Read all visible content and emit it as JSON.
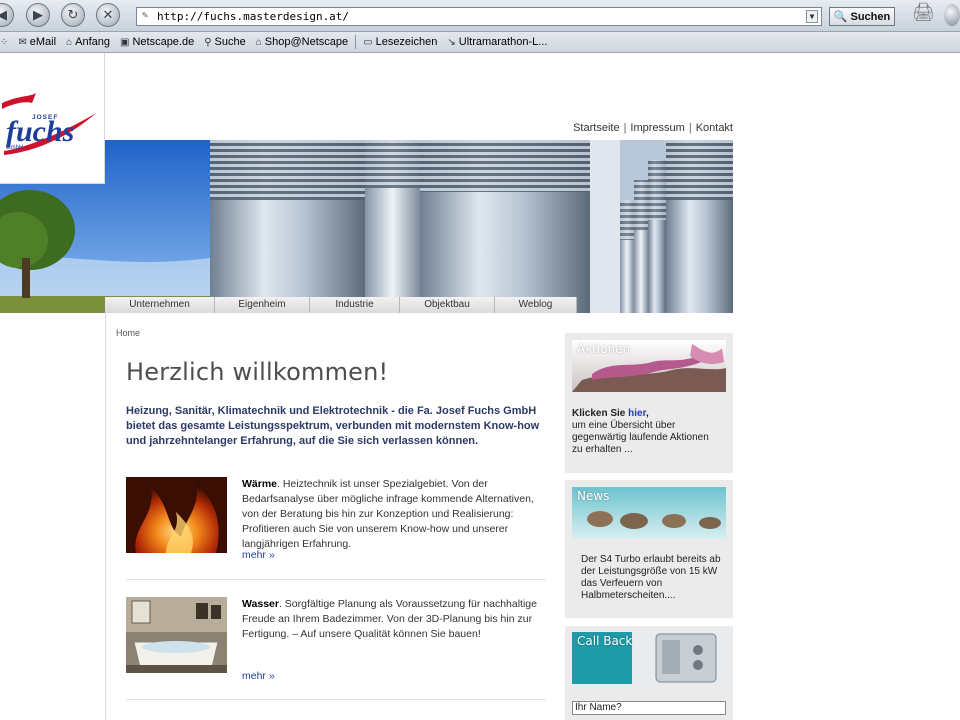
{
  "browser": {
    "url": "http://fuchs.masterdesign.at/",
    "search_button": "Suchen",
    "bookmarks": [
      {
        "label": "eMail",
        "icon": "mail-icon"
      },
      {
        "label": "Anfang",
        "icon": "home-icon"
      },
      {
        "label": "Netscape.de",
        "icon": "my-icon"
      },
      {
        "label": "Suche",
        "icon": "search-icon"
      },
      {
        "label": "Shop@Netscape",
        "icon": "shop-icon"
      },
      {
        "label": "Lesezeichen",
        "icon": "folder-icon"
      },
      {
        "label": "Ultramarathon-L...",
        "icon": "link-icon"
      }
    ]
  },
  "site": {
    "logo": {
      "prefix": "JOSEF",
      "name": "fuchs",
      "suffix": "GmbH"
    },
    "top_links": [
      "Startseite",
      "Impressum",
      "Kontakt"
    ],
    "nav_tabs": [
      "Unternehmen",
      "Eigenheim",
      "Industrie",
      "Objektbau",
      "Weblog"
    ],
    "breadcrumb": "Home",
    "title": "Herzlich willkommen!",
    "intro": "Heizung, Sanitär, Klimatechnik und Elektrotechnik - die Fa. Josef Fuchs GmbH bietet das gesamte Leistungsspektrum, verbunden mit modernstem Know-how und jahrzehntelanger Erfahrung, auf die Sie sich verlassen können.",
    "features": [
      {
        "heading": "Wärme",
        "text": ". Heiztechnik ist unser Spezialgebiet. Von der Bedarfsanalyse über mögliche infrage kommende Alternativen, von der Beratung bis hin zur Konzeption und Realisierung: Profitieren auch Sie von unserem Know-how und unserer langjährigen Erfahrung.",
        "more": "mehr »"
      },
      {
        "heading": "Wasser",
        "text": ". Sorgfältige Planung als Voraussetzung für nachhaltige Freude an Ihrem Badezimmer. Von der 3D-Planung bis hin zur Fertigung. – Auf unsere Qualität können Sie bauen!",
        "more": "mehr »"
      }
    ],
    "sidebar": {
      "aktionen": {
        "label": "Aktionen",
        "lead": "Klicken Sie ",
        "link": "hier",
        "lead_end": ",",
        "text": "um eine Übersicht über gegenwärtig laufende Aktionen zu erhalten ..."
      },
      "news": {
        "label": "News",
        "text": "Der S4 Turbo erlaubt bereits ab der Leistungsgröße von 15 kW das Verfeuern von Halbmeterscheiten...."
      },
      "callback": {
        "label": "Call Back",
        "name_placeholder": "Ihr Name?"
      }
    }
  },
  "colors": {
    "intro_text": "#2b3a67",
    "link": "#1f3f9e",
    "logo_blue": "#1d3f9c",
    "logo_red": "#d0112b"
  }
}
